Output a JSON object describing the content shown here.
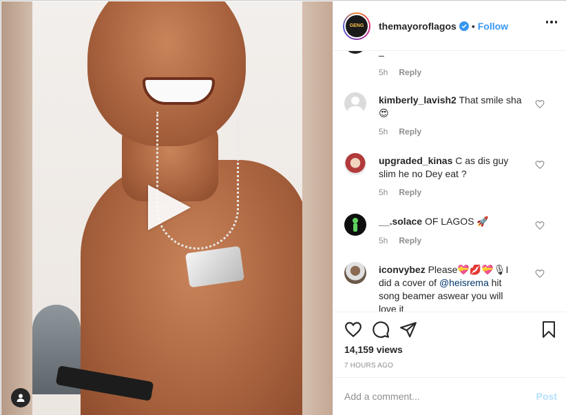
{
  "header": {
    "avatar_text": "GENG",
    "username": "themayoroflagos",
    "separator": "•",
    "follow_label": "Follow"
  },
  "comments": {
    "partial": {
      "text": "_",
      "time": "5h",
      "reply_label": "Reply"
    },
    "items": [
      {
        "username": "kimberly_lavish2",
        "text": "That smile sha 😍",
        "time": "5h",
        "reply_label": "Reply",
        "avatar_color": "#dbdbdb"
      },
      {
        "username": "upgraded_kinas",
        "text": "C as dis guy slim he no Dey eat ?",
        "time": "5h",
        "reply_label": "Reply",
        "avatar_color": "#b23a3a"
      },
      {
        "username": "__.solace",
        "text": "OF LAGOS 🚀",
        "time": "5h",
        "reply_label": "Reply",
        "avatar_color": "#0f0f0f"
      },
      {
        "username": "iconvybez",
        "text_before": "Please💝💋💝🎙I did a cover of ",
        "mention": "@heisrema",
        "text_after": " hit song beamer aswear you will love it",
        "avatar_color": "#6b5a4a"
      }
    ]
  },
  "actions": {
    "views": "14,159 views",
    "time_ago": "7 HOURS AGO"
  },
  "add_comment": {
    "placeholder": "Add a comment...",
    "post_label": "Post"
  },
  "colors": {
    "link_blue": "#3897f0",
    "muted": "#8e8e8e",
    "post_disabled": "#b2dffc"
  }
}
